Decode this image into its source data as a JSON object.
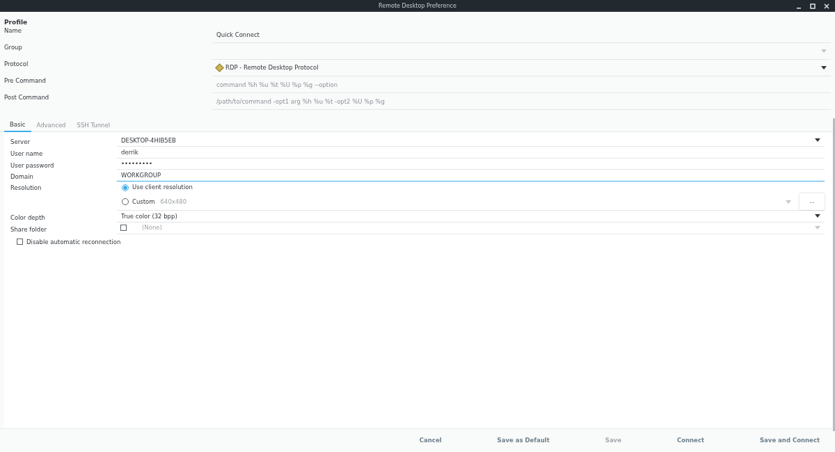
{
  "window": {
    "title": "Remote Desktop Preference"
  },
  "profile": {
    "heading": "Profile",
    "fields": [
      {
        "label": "Name",
        "kind": "entry",
        "value": "Quick Connect",
        "focused": false
      },
      {
        "label": "Group",
        "kind": "combo",
        "disabled": true
      },
      {
        "label": "Protocol",
        "kind": "combo",
        "value": "RDP - Remote Desktop Protocol",
        "icon": true,
        "disabled": false
      },
      {
        "label": "Pre Command",
        "kind": "entry",
        "placeholder": "command %h %u %t %U %p %g --option",
        "focused": false
      },
      {
        "label": "Post Command",
        "kind": "entry",
        "placeholder": "/path/to/command -opt1 arg %h %u %t -opt2 %U %p %g",
        "focused": false
      }
    ]
  },
  "tabs": [
    {
      "label": "Basic",
      "selected": true
    },
    {
      "label": "Advanced",
      "selected": false
    },
    {
      "label": "SSH Tunnel",
      "selected": false
    }
  ],
  "basic": {
    "fields": [
      {
        "label": "Server",
        "kind": "combo",
        "value": "DESKTOP-4HIB5EB",
        "disabled": false
      },
      {
        "label": "User name",
        "kind": "entry",
        "value": "derrik",
        "focused": false
      },
      {
        "label": "User password",
        "kind": "entry",
        "value": "•••••••••",
        "focused": false
      },
      {
        "label": "Domain",
        "kind": "entry",
        "value": "WORKGROUP",
        "focused": true
      },
      {
        "label": "Resolution",
        "kind": "radios",
        "options": [
          {
            "label": "Use client resolution",
            "selected": true
          },
          {
            "label": "Custom",
            "selected": false,
            "hint": "640x480",
            "button": "..."
          }
        ]
      },
      {
        "label": "Color depth",
        "kind": "combo",
        "value": "True color (32 bpp)",
        "disabled": false
      },
      {
        "label": "Share folder",
        "kind": "folder",
        "checked": false,
        "value": "(None)",
        "disabled": true
      }
    ],
    "reconnect": {
      "label": "Disable automatic reconnection",
      "checked": false
    }
  },
  "buttons": [
    {
      "label": "Cancel",
      "disabled": false
    },
    {
      "label": "Save as Default",
      "disabled": false
    },
    {
      "label": "Save",
      "disabled": true
    },
    {
      "label": "Connect",
      "disabled": false
    },
    {
      "label": "Save and Connect",
      "disabled": false
    }
  ]
}
